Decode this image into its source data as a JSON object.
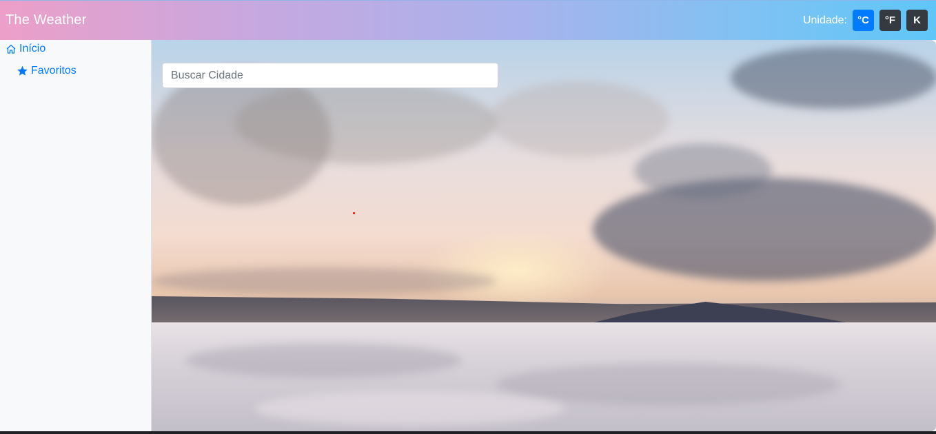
{
  "navbar": {
    "brand": "The Weather",
    "unit_label": "Unidade:",
    "units": [
      {
        "label": "°C",
        "active": true
      },
      {
        "label": "°F",
        "active": false
      },
      {
        "label": "K",
        "active": false
      }
    ]
  },
  "sidebar": {
    "items": [
      {
        "label": "Início",
        "icon": "home-icon"
      },
      {
        "label": "Favoritos",
        "icon": "star-icon"
      }
    ]
  },
  "search": {
    "placeholder": "Buscar Cidade",
    "value": ""
  },
  "colors": {
    "accent": "#007bff",
    "dark_button": "#343a40"
  }
}
